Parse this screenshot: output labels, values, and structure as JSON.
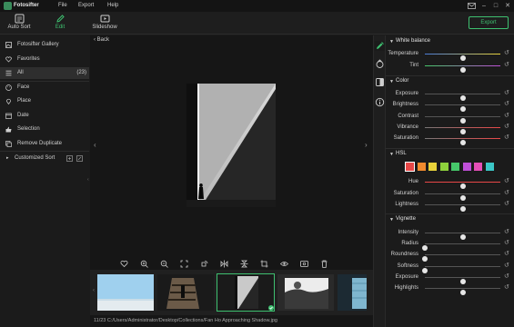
{
  "app": {
    "name": "Fotosifter",
    "menu": [
      "File",
      "Export",
      "Help"
    ]
  },
  "toolbar": {
    "auto_sort": "Auto Sort",
    "edit": "Edit",
    "slideshow": "Slideshow",
    "export": "Export",
    "accent": "#3ec070"
  },
  "sidebar": {
    "items": [
      {
        "label": "Fotosifter Gallery",
        "icon": "gallery-icon"
      },
      {
        "label": "Favorites",
        "icon": "heart-icon"
      },
      {
        "label": "All",
        "count": "(23)",
        "icon": "list-icon",
        "selected": true
      },
      {
        "label": "Face",
        "icon": "face-icon"
      },
      {
        "label": "Place",
        "icon": "place-icon"
      },
      {
        "label": "Date",
        "icon": "calendar-icon"
      },
      {
        "label": "Selection",
        "icon": "thumbs-up-icon"
      },
      {
        "label": "Remove Duplicate",
        "icon": "duplicate-icon"
      }
    ],
    "customized_sort": "Customized Sort"
  },
  "viewer": {
    "back": "Back",
    "status": "11/23  C:/Users/Administrator/Desktop/Collections/Fan Ho Approaching Shadow.jpg"
  },
  "panel": {
    "white_balance": {
      "title": "White balance",
      "rows": [
        {
          "label": "Temperature",
          "value": 0.5
        },
        {
          "label": "Tint",
          "value": 0.5
        }
      ]
    },
    "color": {
      "title": "Color",
      "rows": [
        {
          "label": "Exposure",
          "value": 0.5
        },
        {
          "label": "Brightness",
          "value": 0.5
        },
        {
          "label": "Contrast",
          "value": 0.5
        },
        {
          "label": "Vibrance",
          "value": 0.5
        },
        {
          "label": "Saturation",
          "value": 0.5
        }
      ]
    },
    "hsl": {
      "title": "HSL",
      "swatches": [
        "#e84848",
        "#f08a2e",
        "#e8d23a",
        "#8ed13c",
        "#46c86a",
        "#c04fd8",
        "#e54fb8",
        "#3bc7c7"
      ],
      "rows": [
        {
          "label": "Hue",
          "value": 0.5
        },
        {
          "label": "Saturation",
          "value": 0.5
        },
        {
          "label": "Lightness",
          "value": 0.5
        }
      ]
    },
    "vignette": {
      "title": "Vignette",
      "rows": [
        {
          "label": "Intensity",
          "value": 0.5
        },
        {
          "label": "Radius",
          "value": 0.0
        },
        {
          "label": "Roundness",
          "value": 0.0
        },
        {
          "label": "Softness",
          "value": 0.0
        },
        {
          "label": "Exposure",
          "value": 0.5
        },
        {
          "label": "Highlights",
          "value": 0.5
        }
      ]
    }
  }
}
